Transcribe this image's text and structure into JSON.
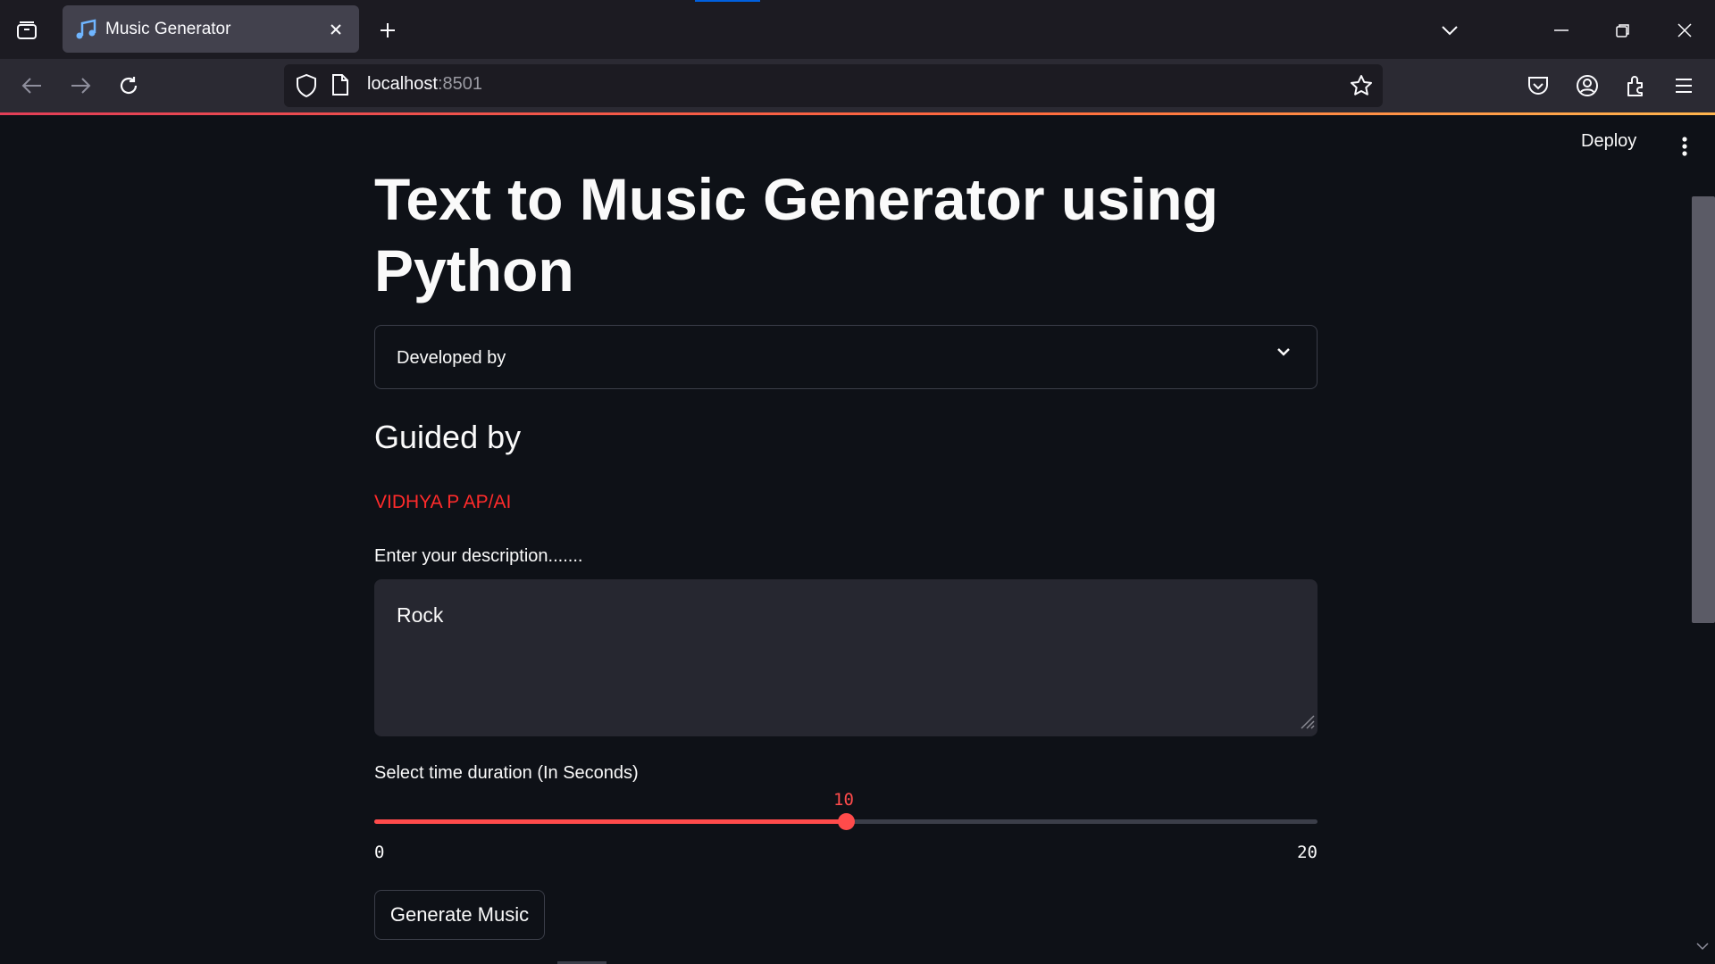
{
  "browser": {
    "tab_title": "Music Generator",
    "url_host": "localhost",
    "url_port": ":8501"
  },
  "header": {
    "deploy_label": "Deploy"
  },
  "main": {
    "title": "Text to Music Generator using Python",
    "expander_label": "Developed by",
    "guided_heading": "Guided by",
    "guide_name": "VIDHYA P AP/AI",
    "description_label": "Enter your description.......",
    "description_value": "Rock",
    "duration_label": "Select time duration (In Seconds)",
    "slider": {
      "min": 0,
      "max": 20,
      "value": 10,
      "min_label": "0",
      "max_label": "20",
      "value_label": "10"
    },
    "generate_label": "Generate Music"
  },
  "colors": {
    "accent": "#ff4b4b",
    "background": "#0e1117",
    "guide_text": "#ff2b2b"
  },
  "icons": [
    "tab-list-icon",
    "music-note-icon",
    "close-tab-icon",
    "new-tab-icon",
    "list-all-tabs-icon",
    "minimize-icon",
    "restore-icon",
    "close-window-icon",
    "back-icon",
    "forward-icon",
    "reload-icon",
    "shield-icon",
    "page-icon",
    "star-icon",
    "pocket-icon",
    "account-icon",
    "extensions-icon",
    "menu-icon",
    "kebab-menu-icon",
    "chevron-down-icon"
  ]
}
